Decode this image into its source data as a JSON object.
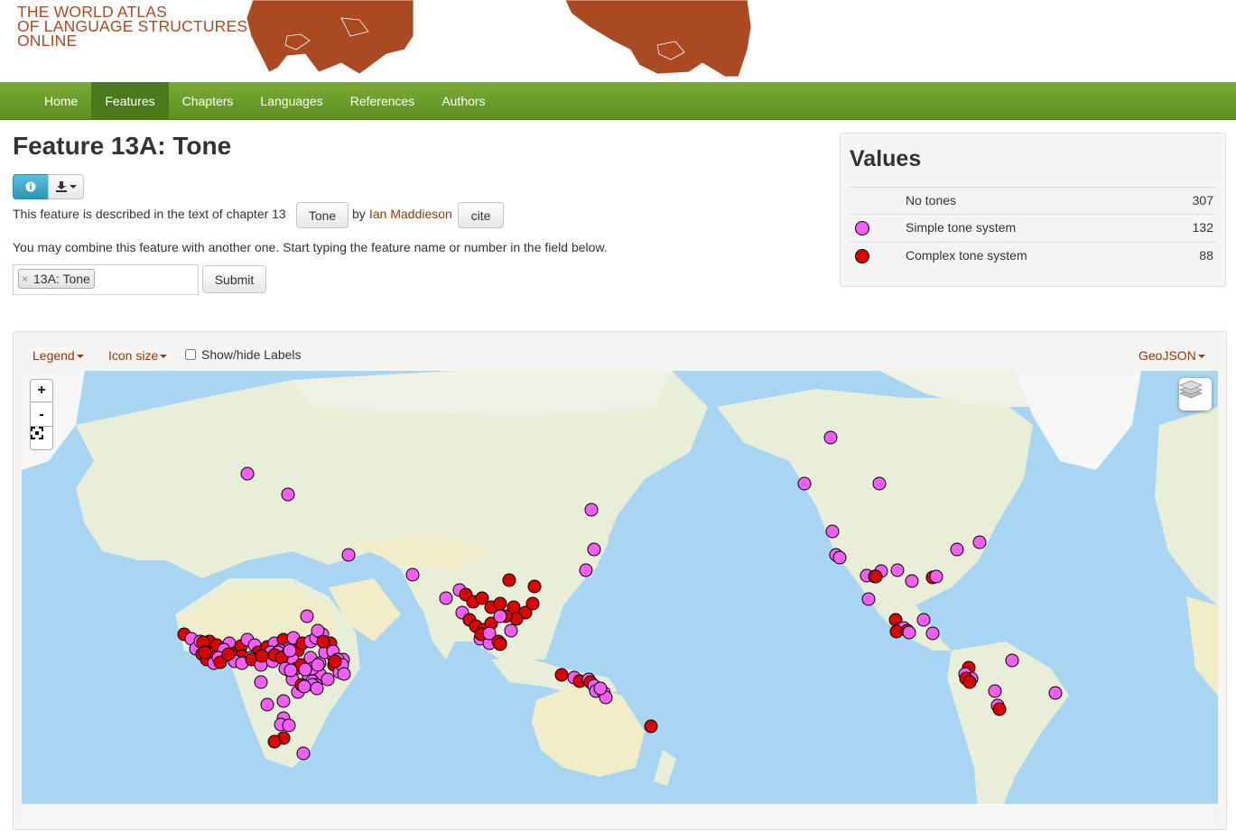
{
  "site": {
    "title_lines": [
      "THE WORLD ATLAS",
      "OF LANGUAGE STRUCTURES",
      "ONLINE"
    ]
  },
  "nav": {
    "items": [
      {
        "label": "Home",
        "active": false
      },
      {
        "label": "Features",
        "active": true
      },
      {
        "label": "Chapters",
        "active": false
      },
      {
        "label": "Languages",
        "active": false
      },
      {
        "label": "References",
        "active": false
      },
      {
        "label": "Authors",
        "active": false
      }
    ]
  },
  "feature": {
    "title": "Feature 13A: Tone",
    "info_icon": "info-icon",
    "download_icon": "download-icon",
    "desc_prefix": "This feature is described in the text of chapter 13",
    "chapter_button": "Tone",
    "by": "by",
    "author": "Ian Maddieson",
    "cite_button": "cite",
    "combine_text": "You may combine this feature with another one. Start typing the feature name or number in the field below.",
    "token_label": "13A: Tone",
    "token_remove": "×",
    "submit_label": "Submit"
  },
  "values": {
    "title": "Values",
    "rows": [
      {
        "label": "No tones",
        "count": "307",
        "color": ""
      },
      {
        "label": "Simple tone system",
        "count": "132",
        "color": "#f55ef5"
      },
      {
        "label": "Complex tone system",
        "count": "88",
        "color": "#dd0000"
      }
    ]
  },
  "map": {
    "legend_label": "Legend",
    "icon_size_label": "Icon size",
    "labels_toggle": "Show/hide Labels",
    "labels_checked": false,
    "geojson_label": "GeoJSON",
    "zoom_in": "+",
    "zoom_out": "-",
    "colors": {
      "simple": "#f55ef5",
      "complex": "#dd0000",
      "ocean": "#a8d5f2",
      "land": "#e9eed8",
      "desert": "#f1edc8",
      "ice": "#f6f6f6"
    }
  }
}
